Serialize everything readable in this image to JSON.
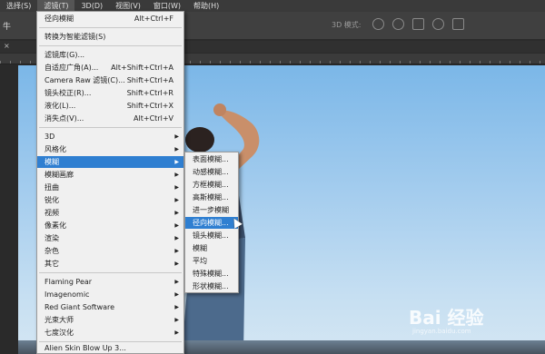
{
  "menubar": {
    "items": [
      "选择(S)",
      "滤镜(T)",
      "3D(D)",
      "视图(V)",
      "窗口(W)",
      "帮助(H)"
    ],
    "active_index": 1
  },
  "options_bar": {
    "left_glyph": "牛",
    "mode_3d_label": "3D 模式:"
  },
  "doc_tab": {
    "glyph": "×"
  },
  "filter_menu": {
    "items": [
      {
        "label": "径向模糊",
        "shortcut": "Alt+Ctrl+F"
      },
      {
        "label": "转换为智能滤镜(S)",
        "shortcut": ""
      },
      {
        "label": "滤镜库(G)...",
        "shortcut": ""
      },
      {
        "label": "自适应广角(A)...",
        "shortcut": "Alt+Shift+Ctrl+A"
      },
      {
        "label": "Camera Raw 滤镜(C)...",
        "shortcut": "Shift+Ctrl+A"
      },
      {
        "label": "镜头校正(R)...",
        "shortcut": "Shift+Ctrl+R"
      },
      {
        "label": "液化(L)...",
        "shortcut": "Shift+Ctrl+X"
      },
      {
        "label": "消失点(V)...",
        "shortcut": "Alt+Ctrl+V"
      },
      {
        "label": "3D",
        "shortcut": ""
      },
      {
        "label": "风格化",
        "shortcut": ""
      },
      {
        "label": "模糊",
        "shortcut": ""
      },
      {
        "label": "模糊画廊",
        "shortcut": ""
      },
      {
        "label": "扭曲",
        "shortcut": ""
      },
      {
        "label": "锐化",
        "shortcut": ""
      },
      {
        "label": "视频",
        "shortcut": ""
      },
      {
        "label": "像素化",
        "shortcut": ""
      },
      {
        "label": "渲染",
        "shortcut": ""
      },
      {
        "label": "杂色",
        "shortcut": ""
      },
      {
        "label": "其它",
        "shortcut": ""
      },
      {
        "label": "Flaming Pear",
        "shortcut": ""
      },
      {
        "label": "Imagenomic",
        "shortcut": ""
      },
      {
        "label": "Red Giant Software",
        "shortcut": ""
      },
      {
        "label": "光束大师",
        "shortcut": ""
      },
      {
        "label": "七度汉化",
        "shortcut": ""
      },
      {
        "label": "Alien Skin Blow Up 3...",
        "shortcut": ""
      }
    ],
    "highlighted_index": 10
  },
  "blur_submenu": {
    "items": [
      "表面模糊...",
      "动感模糊...",
      "方框模糊...",
      "高斯模糊...",
      "进一步模糊",
      "径向模糊...",
      "镜头模糊...",
      "模糊",
      "平均",
      "特殊模糊...",
      "形状模糊..."
    ],
    "highlighted_index": 5
  },
  "watermark": {
    "text": "Bai 经验",
    "sub": "jingyan.baidu.com"
  },
  "colors": {
    "menu_bg": "#f0f0f0",
    "highlight": "#2f7fd1",
    "chrome": "#404040"
  }
}
